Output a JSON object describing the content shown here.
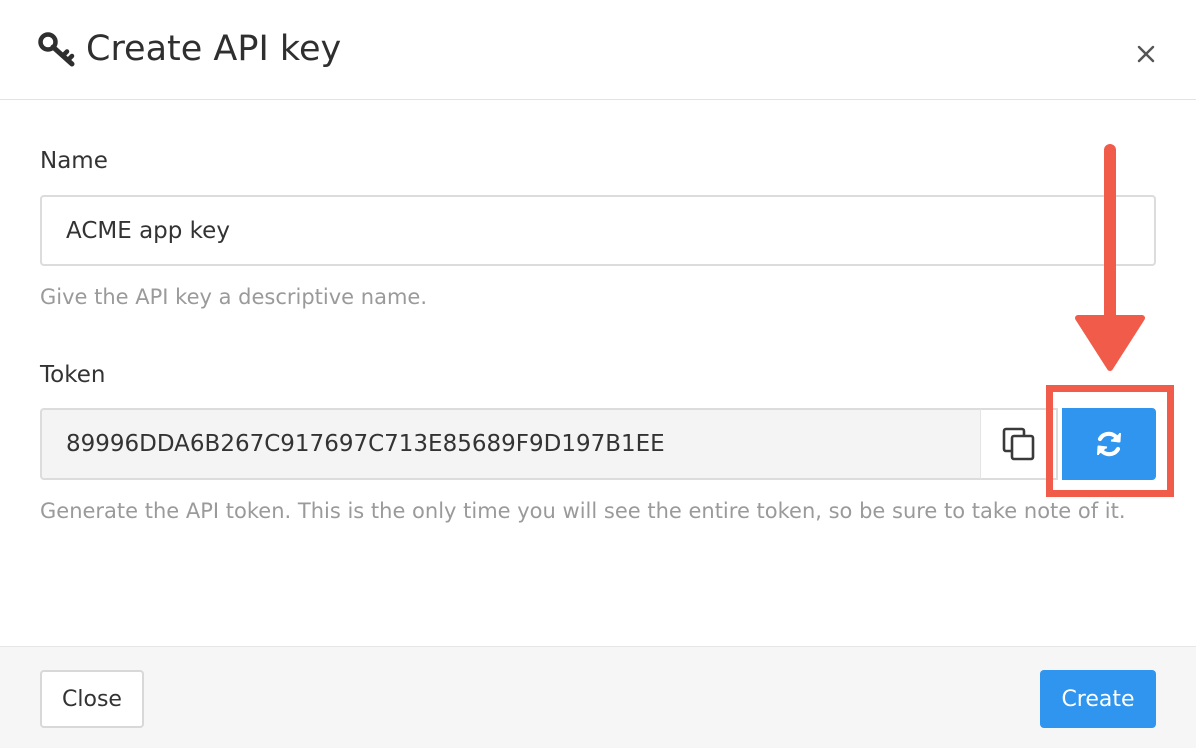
{
  "dialog": {
    "title": "Create API key",
    "title_icon": "key-icon",
    "close_icon": "close-icon"
  },
  "name_field": {
    "label": "Name",
    "value": "ACME app key",
    "help": "Give the API key a descriptive name."
  },
  "token_field": {
    "label": "Token",
    "value": "89996DDA6B267C917697C713E85689F9D197B1EE",
    "help": "Generate the API token. This is the only time you will see the entire token, so be sure to take note of it.",
    "copy_icon": "copy-icon",
    "regenerate_icon": "refresh-icon"
  },
  "footer": {
    "close_label": "Close",
    "create_label": "Create"
  },
  "annotation": {
    "arrow_icon": "arrow-down-icon",
    "highlight": "highlight-box"
  },
  "colors": {
    "accent": "#2f95ee",
    "annotation": "#f05b4a",
    "help_text": "#9a9a9a"
  }
}
